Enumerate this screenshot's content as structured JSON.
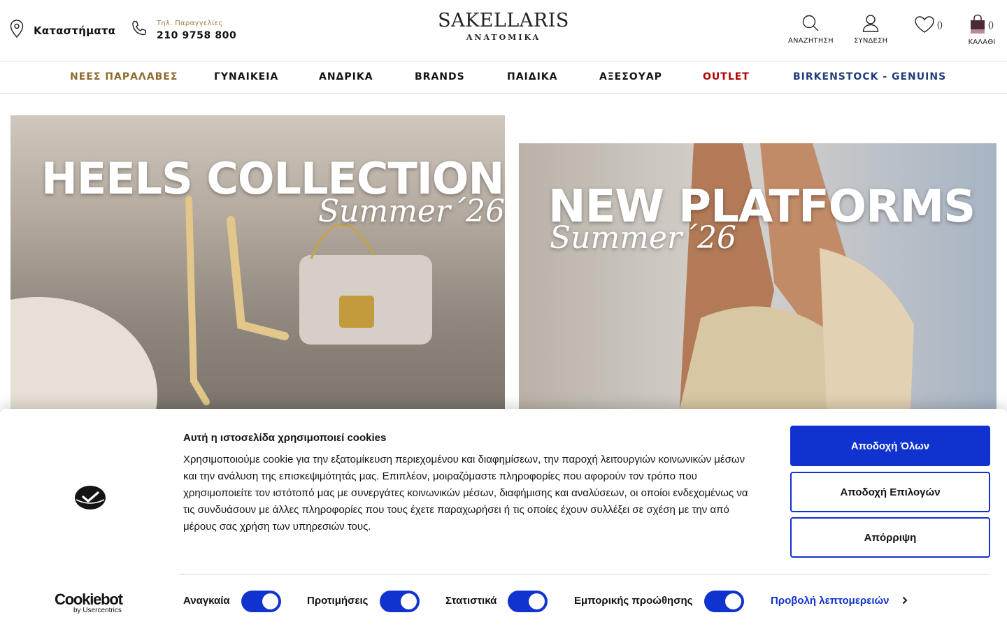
{
  "header": {
    "stores_label": "Καταστήματα",
    "phone_caption": "Τηλ. Παραγγελίες",
    "phone_number": "210 9758 800",
    "logo_top": "SAKELLARIS",
    "logo_bottom": "ANATOMIKA",
    "search_label": "ΑΝΑΖΗΤΗΣΗ",
    "login_label": "ΣΥΝΔΕΣΗ",
    "wishlist_count": "()",
    "cart_count": "()",
    "cart_label": "ΚΑΛΑΘΙ"
  },
  "nav": {
    "items": [
      {
        "label": "ΝΕΕΣ ΠΑΡΑΛΑΒΕΣ",
        "color": "#8f6b2e"
      },
      {
        "label": "ΓΥΝΑΙΚΕΙΑ",
        "color": "#141414"
      },
      {
        "label": "ΑΝΔΡΙΚΑ",
        "color": "#141414"
      },
      {
        "label": "BRANDS",
        "color": "#141414"
      },
      {
        "label": "ΠΑΙΔΙΚΑ",
        "color": "#141414"
      },
      {
        "label": "ΑΞΕΣΟΥΑΡ",
        "color": "#141414"
      },
      {
        "label": "OUTLET",
        "color": "#b30000"
      },
      {
        "label": "BIRKENSTOCK - GENUINS",
        "color": "#1f3f7a"
      }
    ]
  },
  "banners": {
    "left": {
      "title": "HEELS COLLECTION",
      "script": "Summer´26"
    },
    "right": {
      "title": "NEW PLATFORMS",
      "script": "Summer´26"
    }
  },
  "cookie": {
    "title": "Αυτή η ιστοσελίδα χρησιμοποιεί cookies",
    "text": "Χρησιμοποιούμε cookie για την εξατομίκευση περιεχομένου και διαφημίσεων, την παροχή λειτουργιών κοινωνικών μέσων και την ανάλυση της επισκεψιμότητάς μας. Επιπλέον, μοιραζόμαστε πληροφορίες που αφορούν τον τρόπο που χρησιμοποιείτε τον ιστότοπό μας με συνεργάτες κοινωνικών μέσων, διαφήμισης και αναλύσεων, οι οποίοι ενδεχομένως να τις συνδυάσουν με άλλες πληροφορίες που τους έχετε παραχωρήσει ή τις οποίες έχουν συλλέξει σε σχέση με την από μέρους σας χρήση των υπηρεσιών τους.",
    "accept_all": "Αποδοχή Όλων",
    "accept_selected": "Αποδοχή Επιλογών",
    "reject": "Απόρριψη",
    "toggles": [
      {
        "label": "Αναγκαία",
        "on": true
      },
      {
        "label": "Προτιμήσεις",
        "on": true
      },
      {
        "label": "Στατιστικά",
        "on": true
      },
      {
        "label": "Εμπορικής προώθησης",
        "on": true
      }
    ],
    "details_link": "Προβολή λεπτομερειών",
    "brand_name": "Cookiebot",
    "brand_sub": "by Usercentrics",
    "accent_color": "#1032cf"
  }
}
